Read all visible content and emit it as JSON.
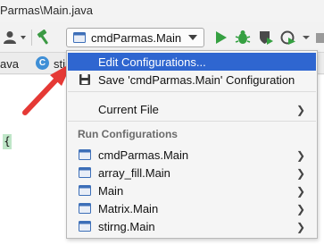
{
  "title": {
    "text": "Parmas\\Main.java"
  },
  "toolbar": {
    "run_config": "cmdParmas.Main"
  },
  "tabs": [
    {
      "label": "ava"
    },
    {
      "label": "stir",
      "badge": "C"
    }
  ],
  "editor": {
    "brace": "{"
  },
  "menu": {
    "edit_configurations": "Edit Configurations...",
    "save_configuration": "Save 'cmdParmas.Main' Configuration",
    "current_file": "Current File",
    "run_configurations_header": "Run Configurations",
    "run_configurations": [
      {
        "label": "cmdParmas.Main"
      },
      {
        "label": "array_fill.Main"
      },
      {
        "label": "Main"
      },
      {
        "label": "Matrix.Main"
      },
      {
        "label": "stirng.Main"
      }
    ]
  },
  "colors": {
    "selection": "#2f66d0",
    "run_green": "#35a041",
    "annotation_arrow": "#e53935",
    "brace_highlight": "#bfe6c8"
  }
}
